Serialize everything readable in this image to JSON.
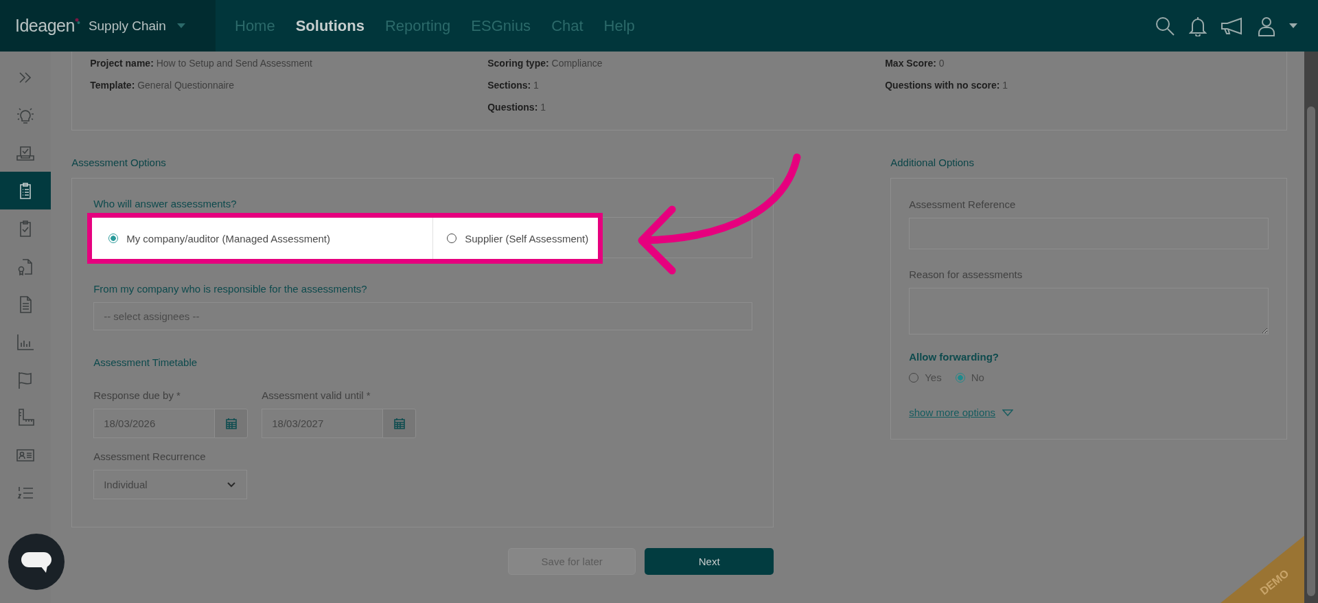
{
  "header": {
    "logo": "Ideagen",
    "product": "Supply Chain",
    "nav": [
      {
        "label": "Home",
        "selected": false
      },
      {
        "label": "Solutions",
        "selected": true
      },
      {
        "label": "Reporting",
        "selected": false
      },
      {
        "label": "ESGnius",
        "selected": false
      },
      {
        "label": "Chat",
        "selected": false
      },
      {
        "label": "Help",
        "selected": false
      }
    ]
  },
  "sidebar": {
    "items": [
      {
        "kind": "expand",
        "selected": false
      },
      {
        "kind": "ideas",
        "selected": false
      },
      {
        "kind": "inbox",
        "selected": false
      },
      {
        "kind": "assessments",
        "selected": true
      },
      {
        "kind": "audits",
        "selected": false
      },
      {
        "kind": "certificates",
        "selected": false
      },
      {
        "kind": "documents",
        "selected": false
      },
      {
        "kind": "reports",
        "selected": false
      },
      {
        "kind": "issues",
        "selected": false
      },
      {
        "kind": "measures",
        "selected": false
      },
      {
        "kind": "contacts",
        "selected": false
      },
      {
        "kind": "lists",
        "selected": false
      }
    ]
  },
  "summary": {
    "columns": [
      [
        "**Project name:** How to Setup and Send Assessment",
        "**Template:** General Questionnaire"
      ],
      [
        "**Scoring type:** Compliance",
        "**Sections:** 1",
        "**Questions:** 1"
      ],
      [
        "**Max Score:** 0",
        "**Questions with no score:** 1"
      ]
    ]
  },
  "assessment_options": {
    "title": "Assessment Options",
    "question": "Who will answer assessments?",
    "answerers": [
      {
        "label": "My company/auditor (Managed Assessment)",
        "selected": true
      },
      {
        "label": "Supplier (Self Assessment)",
        "selected": false
      }
    ],
    "responsible": {
      "label": "From my company who is responsible for the assessments?",
      "placeholder": "-- select assignees --"
    },
    "timetable_title": "Assessment Timetable",
    "dates": [
      {
        "label": "Response due by *",
        "value": "18/03/2026"
      },
      {
        "label": "Assessment valid until *",
        "value": "18/03/2027"
      }
    ],
    "recurrence": {
      "label": "Assessment Recurrence",
      "value": "Individual"
    }
  },
  "additional_options": {
    "title": "Additional Options",
    "reference": {
      "label": "Assessment Reference"
    },
    "reason": {
      "label": "Reason for assessments"
    },
    "forwarding": {
      "label": "Allow forwarding?",
      "options": [
        {
          "label": "Yes",
          "selected": false
        },
        {
          "label": "No",
          "selected": true
        }
      ]
    },
    "more_link": "show more options"
  },
  "buttons": [
    {
      "label": "Save for later",
      "kind": "secondary"
    },
    {
      "label": "Next",
      "kind": "primary"
    }
  ],
  "ribbon": "DEMO"
}
